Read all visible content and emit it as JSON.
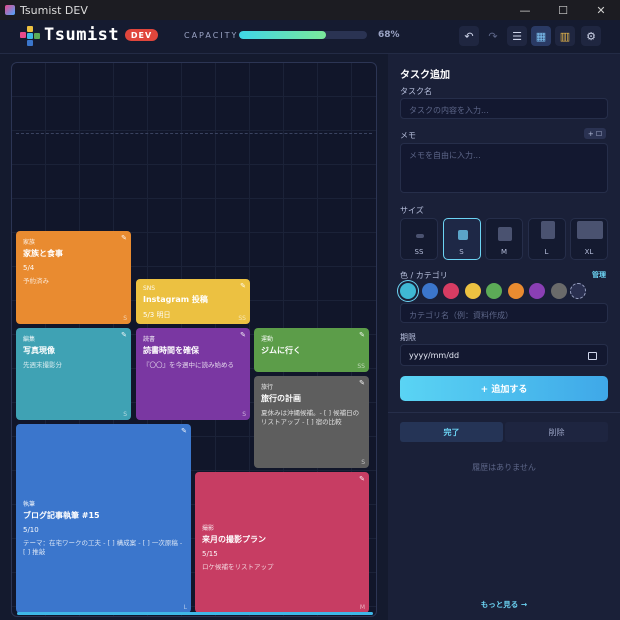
{
  "window": {
    "title": "Tsumist DEV",
    "controls": [
      "—",
      "☐",
      "✕"
    ]
  },
  "header": {
    "brand": "Tsumist",
    "badge": "DEV",
    "capacity_label": "CAPACITY",
    "capacity_percent": 68,
    "capacity_text": "68%",
    "buttons": [
      {
        "name": "undo-button",
        "glyph": "↶"
      },
      {
        "name": "redo-button",
        "glyph": "↷"
      },
      {
        "name": "list-view-button",
        "glyph": "☰"
      },
      {
        "name": "calendar-button",
        "glyph": "▦"
      },
      {
        "name": "stats-button",
        "glyph": "▥"
      },
      {
        "name": "settings-button",
        "glyph": "⚙"
      }
    ]
  },
  "board": {
    "cards": [
      {
        "category": "家族",
        "title": "家族と食事",
        "date": "5/4",
        "memo": "予約済み",
        "size": "S",
        "color": "#e98b30"
      },
      {
        "category": "SNS",
        "title": "Instagram 投稿",
        "date": "5/3 明日",
        "memo": "",
        "size": "SS",
        "color": "#ecc141"
      },
      {
        "category": "編集",
        "title": "写真現像",
        "date": "",
        "memo": "先週末撮影分",
        "size": "S",
        "color": "#3fa2b4"
      },
      {
        "category": "読書",
        "title": "読書時間を確保",
        "date": "",
        "memo": "『〇〇』を今週中に読み始める",
        "size": "S",
        "color": "#7a37a2"
      },
      {
        "category": "運動",
        "title": "ジムに行く",
        "date": "",
        "memo": "",
        "size": "SS",
        "color": "#5c9d49"
      },
      {
        "category": "旅行",
        "title": "旅行の計画",
        "date": "",
        "memo": "夏休みは沖縄候補。- [ ] 候補日のリストアップ - [ ] 宿の比較",
        "size": "S",
        "color": "#5e5e5e"
      },
      {
        "category": "執筆",
        "title": "ブログ記事執筆 #15",
        "date": "5/10",
        "memo": "テーマ：在宅ワークの工夫 - [ ] 構成案 - [ ] 一次原稿 - [ ] 推敲",
        "size": "L",
        "color": "#3b76cc"
      },
      {
        "category": "撮影",
        "title": "来月の撮影プラン",
        "date": "5/15",
        "memo": "ロケ候補をリストアップ",
        "size": "M",
        "color": "#c73d63"
      }
    ]
  },
  "panel": {
    "title": "タスク追加",
    "task_name_label": "タスク名",
    "task_name_placeholder": "タスクの内容を入力...",
    "memo_label": "メモ",
    "memo_button": "+ ☐",
    "memo_placeholder": "メモを自由に入力...",
    "size_label": "サイズ",
    "sizes": [
      "SS",
      "S",
      "M",
      "L",
      "XL"
    ],
    "selected_size": "S",
    "color_label": "色 / カテゴリ",
    "manage_label": "管理",
    "colors": [
      "#3fb8d4",
      "#3b76cc",
      "#d63c63",
      "#ecc141",
      "#5cab57",
      "#e98b30",
      "#8a3fb4",
      "#6a6a6a"
    ],
    "category_placeholder": "カテゴリ名（例：資料作成）",
    "due_label": "期限",
    "due_placeholder": "yyyy/mm/dd",
    "add_button": "+ 追加する",
    "tabs": [
      "完了",
      "削除"
    ],
    "empty_history": "履歴はありません",
    "more_link": "もっと見る →"
  }
}
